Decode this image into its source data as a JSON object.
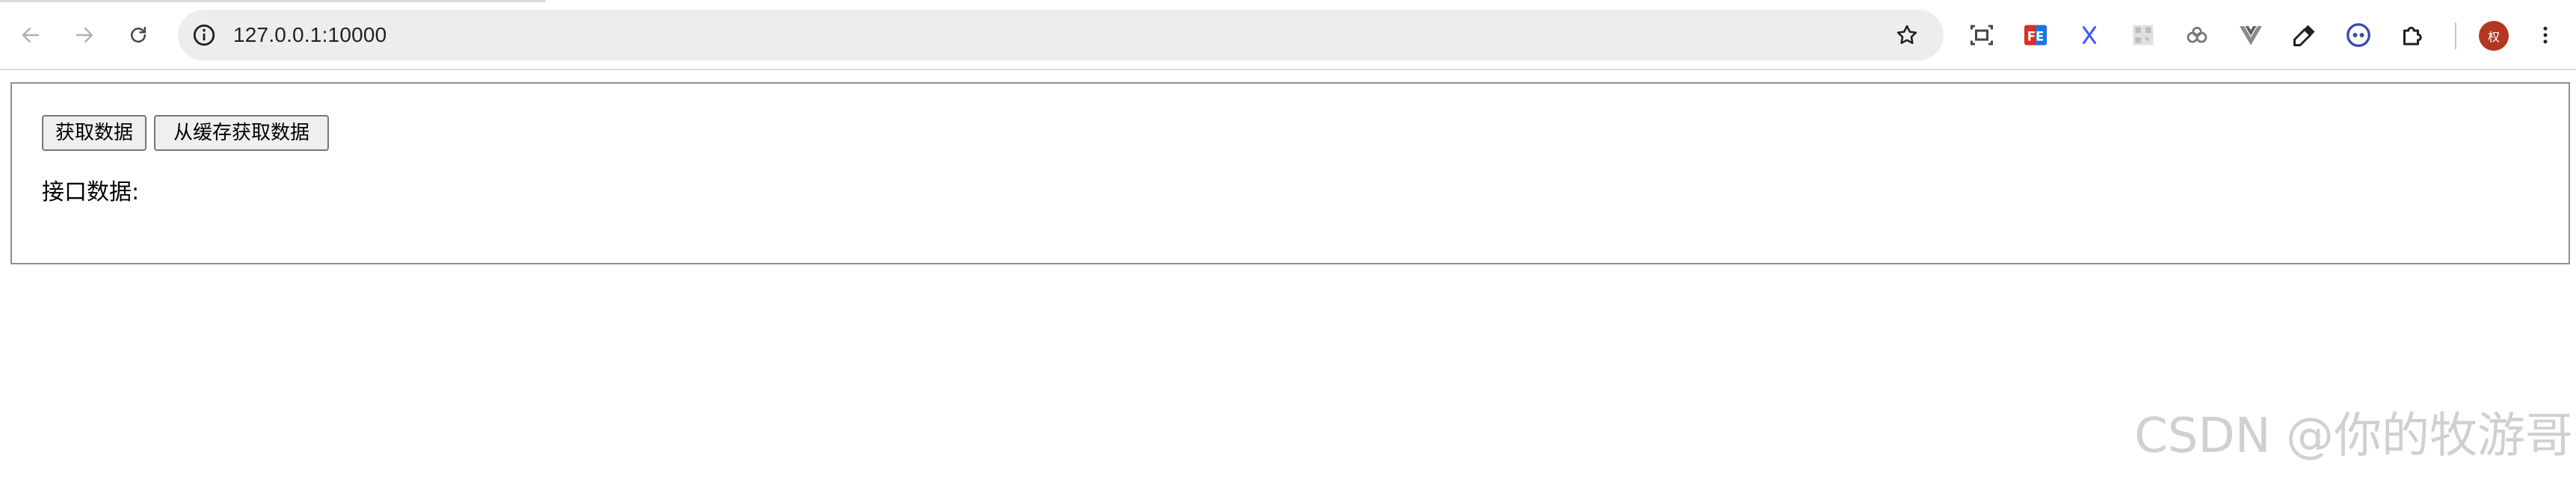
{
  "browser": {
    "url": "127.0.0.1:10000",
    "profile_initial": "权"
  },
  "page": {
    "buttons": {
      "fetch_label": "获取数据",
      "cache_label": "从缓存获取数据"
    },
    "data_label": "接口数据:"
  },
  "watermark": "CSDN @你的牧游哥",
  "colors": {
    "avatar_bg": "#b3361f",
    "omnibox_bg": "#eeeded",
    "button_bg": "#efefef",
    "content_border": "#8f8f8f"
  },
  "icons": {
    "nav": [
      "back-arrow-icon",
      "forward-arrow-icon",
      "reload-icon"
    ],
    "omnibox": [
      "site-info-icon",
      "bookmark-star-icon"
    ],
    "extensions": [
      "screenshot-icon",
      "fe-extension-icon",
      "x-extension-icon",
      "qr-extension-icon",
      "cloud-extension-icon",
      "vue-devtools-icon",
      "eyedropper-icon",
      "face-extension-icon",
      "extensions-puzzle-icon"
    ],
    "menu": "more-vert-icon"
  }
}
